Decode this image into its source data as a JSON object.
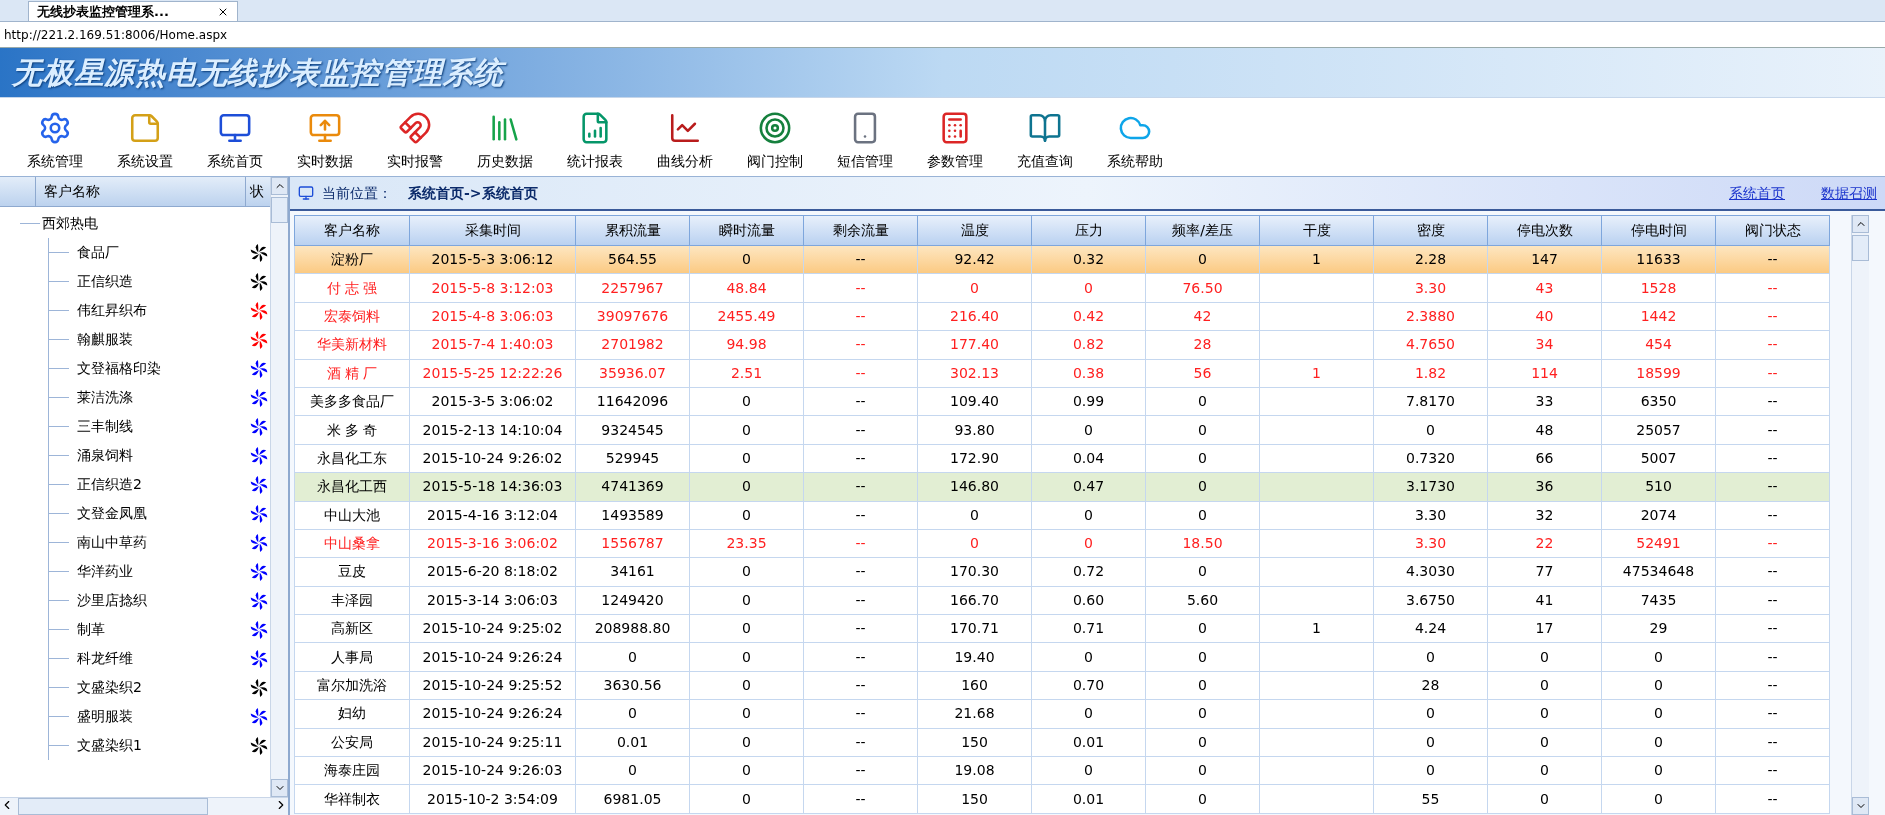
{
  "browser": {
    "tab_title": "无线抄表监控管理系...",
    "address": "http://221.2.169.51:8006/Home.aspx"
  },
  "banner": {
    "title": "无极星源热电无线抄表监控管理系统"
  },
  "toolbar": [
    {
      "label": "系统管理",
      "kind": "gear"
    },
    {
      "label": "系统设置",
      "kind": "note"
    },
    {
      "label": "系统首页",
      "kind": "monitor"
    },
    {
      "label": "实时数据",
      "kind": "import"
    },
    {
      "label": "实时报警",
      "kind": "magnet"
    },
    {
      "label": "历史数据",
      "kind": "binders"
    },
    {
      "label": "统计报表",
      "kind": "report"
    },
    {
      "label": "曲线分析",
      "kind": "chart"
    },
    {
      "label": "阀门控制",
      "kind": "target"
    },
    {
      "label": "短信管理",
      "kind": "phone"
    },
    {
      "label": "参数管理",
      "kind": "calc"
    },
    {
      "label": "充值查询",
      "kind": "books"
    },
    {
      "label": "系统帮助",
      "kind": "cloud"
    }
  ],
  "sidebar": {
    "columns": [
      "客户名称",
      "状"
    ],
    "tree": [
      {
        "label": "西郊热电",
        "children": [
          {
            "label": "食品厂",
            "color": "#000000"
          },
          {
            "label": "正信织造",
            "color": "#000000"
          },
          {
            "label": "伟红昇织布",
            "color": "#ff0000"
          },
          {
            "label": "翰麒服装",
            "color": "#ff0000"
          },
          {
            "label": "文登福格印染",
            "color": "#0000ff"
          },
          {
            "label": "莱洁洗涤",
            "color": "#0000ff"
          },
          {
            "label": "三丰制线",
            "color": "#0000ff"
          },
          {
            "label": "涌泉饲料",
            "color": "#0000ff"
          },
          {
            "label": "正信织造2",
            "color": "#0000ff"
          },
          {
            "label": "文登金凤凰",
            "color": "#0000ff"
          },
          {
            "label": "南山中草药",
            "color": "#0000ff"
          },
          {
            "label": "华洋药业",
            "color": "#0000ff"
          },
          {
            "label": "沙里店捻织",
            "color": "#0000ff"
          },
          {
            "label": "制革",
            "color": "#0000ff"
          },
          {
            "label": "科龙纤维",
            "color": "#0000ff"
          },
          {
            "label": "文盛染织2",
            "color": "#000000"
          },
          {
            "label": "盛明服装",
            "color": "#0000ff"
          },
          {
            "label": "文盛染织1",
            "color": "#000000"
          }
        ]
      }
    ]
  },
  "breadcrumb": {
    "label": "当前位置：",
    "path": "系统首页->系统首页"
  },
  "links": [
    "系统首页",
    "数据召测"
  ],
  "table": {
    "columns": [
      "客户名称",
      "采集时间",
      "累积流量",
      "瞬时流量",
      "剩余流量",
      "温度",
      "压力",
      "频率/差压",
      "干度",
      "密度",
      "停电次数",
      "停电时间",
      "阀门状态"
    ],
    "rows": [
      {
        "selected": true,
        "hovered": false,
        "alarm": false,
        "cells": [
          "淀粉厂",
          "2015-5-3 3:06:12",
          "564.55",
          "0",
          "--",
          "92.42",
          "0.32",
          "0",
          "1",
          "2.28",
          "147",
          "11633",
          "--"
        ]
      },
      {
        "selected": false,
        "hovered": false,
        "alarm": true,
        "cells": [
          "付 志 强",
          "2015-5-8 3:12:03",
          "2257967",
          "48.84",
          "--",
          "0",
          "0",
          "76.50",
          "",
          "3.30",
          "43",
          "1528",
          "--"
        ]
      },
      {
        "selected": false,
        "hovered": false,
        "alarm": true,
        "cells": [
          "宏泰饲料",
          "2015-4-8 3:06:03",
          "39097676",
          "2455.49",
          "--",
          "216.40",
          "0.42",
          "42",
          "",
          "2.3880",
          "40",
          "1442",
          "--"
        ]
      },
      {
        "selected": false,
        "hovered": false,
        "alarm": true,
        "cells": [
          "华美新材料",
          "2015-7-4 1:40:03",
          "2701982",
          "94.98",
          "--",
          "177.40",
          "0.82",
          "28",
          "",
          "4.7650",
          "34",
          "454",
          "--"
        ]
      },
      {
        "selected": false,
        "hovered": false,
        "alarm": true,
        "cells": [
          "酒 精 厂",
          "2015-5-25 12:22:26",
          "35936.07",
          "2.51",
          "--",
          "302.13",
          "0.38",
          "56",
          "1",
          "1.82",
          "114",
          "18599",
          "--"
        ]
      },
      {
        "selected": false,
        "hovered": false,
        "alarm": false,
        "cells": [
          "美多多食品厂",
          "2015-3-5 3:06:02",
          "11642096",
          "0",
          "--",
          "109.40",
          "0.99",
          "0",
          "",
          "7.8170",
          "33",
          "6350",
          "--"
        ]
      },
      {
        "selected": false,
        "hovered": false,
        "alarm": false,
        "cells": [
          "米 多 奇",
          "2015-2-13 14:10:04",
          "9324545",
          "0",
          "--",
          "93.80",
          "0",
          "0",
          "",
          "0",
          "48",
          "25057",
          "--"
        ]
      },
      {
        "selected": false,
        "hovered": false,
        "alarm": false,
        "cells": [
          "永昌化工东",
          "2015-10-24 9:26:02",
          "529945",
          "0",
          "--",
          "172.90",
          "0.04",
          "0",
          "",
          "0.7320",
          "66",
          "5007",
          "--"
        ]
      },
      {
        "selected": false,
        "hovered": true,
        "alarm": false,
        "cells": [
          "永昌化工西",
          "2015-5-18 14:36:03",
          "4741369",
          "0",
          "--",
          "146.80",
          "0.47",
          "0",
          "",
          "3.1730",
          "36",
          "510",
          "--"
        ]
      },
      {
        "selected": false,
        "hovered": false,
        "alarm": false,
        "cells": [
          "中山大池",
          "2015-4-16 3:12:04",
          "1493589",
          "0",
          "--",
          "0",
          "0",
          "0",
          "",
          "3.30",
          "32",
          "2074",
          "--"
        ]
      },
      {
        "selected": false,
        "hovered": false,
        "alarm": true,
        "cells": [
          "中山桑拿",
          "2015-3-16 3:06:02",
          "1556787",
          "23.35",
          "--",
          "0",
          "0",
          "18.50",
          "",
          "3.30",
          "22",
          "52491",
          "--"
        ]
      },
      {
        "selected": false,
        "hovered": false,
        "alarm": false,
        "cells": [
          "豆皮",
          "2015-6-20 8:18:02",
          "34161",
          "0",
          "--",
          "170.30",
          "0.72",
          "0",
          "",
          "4.3030",
          "77",
          "47534648",
          "--"
        ]
      },
      {
        "selected": false,
        "hovered": false,
        "alarm": false,
        "cells": [
          "丰泽园",
          "2015-3-14 3:06:03",
          "1249420",
          "0",
          "--",
          "166.70",
          "0.60",
          "5.60",
          "",
          "3.6750",
          "41",
          "7435",
          "--"
        ]
      },
      {
        "selected": false,
        "hovered": false,
        "alarm": false,
        "cells": [
          "高新区",
          "2015-10-24 9:25:02",
          "208988.80",
          "0",
          "--",
          "170.71",
          "0.71",
          "0",
          "1",
          "4.24",
          "17",
          "29",
          "--"
        ]
      },
      {
        "selected": false,
        "hovered": false,
        "alarm": false,
        "cells": [
          "人事局",
          "2015-10-24 9:26:24",
          "0",
          "0",
          "--",
          "19.40",
          "0",
          "0",
          "",
          "0",
          "0",
          "0",
          "--"
        ]
      },
      {
        "selected": false,
        "hovered": false,
        "alarm": false,
        "cells": [
          "富尔加洗浴",
          "2015-10-24 9:25:52",
          "3630.56",
          "0",
          "--",
          "160",
          "0.70",
          "0",
          "",
          "28",
          "0",
          "0",
          "--"
        ]
      },
      {
        "selected": false,
        "hovered": false,
        "alarm": false,
        "cells": [
          "妇幼",
          "2015-10-24 9:26:24",
          "0",
          "0",
          "--",
          "21.68",
          "0",
          "0",
          "",
          "0",
          "0",
          "0",
          "--"
        ]
      },
      {
        "selected": false,
        "hovered": false,
        "alarm": false,
        "cells": [
          "公安局",
          "2015-10-24 9:25:11",
          "0.01",
          "0",
          "--",
          "150",
          "0.01",
          "0",
          "",
          "0",
          "0",
          "0",
          "--"
        ]
      },
      {
        "selected": false,
        "hovered": false,
        "alarm": false,
        "cells": [
          "海泰庄园",
          "2015-10-24 9:26:03",
          "0",
          "0",
          "--",
          "19.08",
          "0",
          "0",
          "",
          "0",
          "0",
          "0",
          "--"
        ]
      },
      {
        "selected": false,
        "hovered": false,
        "alarm": false,
        "cells": [
          "华祥制衣",
          "2015-10-2 3:54:09",
          "6981.05",
          "0",
          "--",
          "150",
          "0.01",
          "0",
          "",
          "55",
          "0",
          "0",
          "--"
        ]
      }
    ]
  }
}
